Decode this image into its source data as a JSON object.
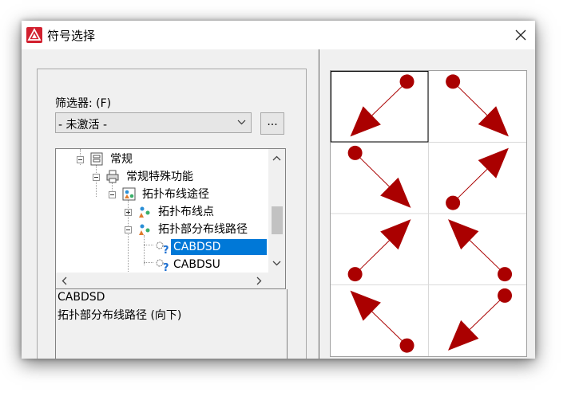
{
  "window": {
    "title": "符号选择"
  },
  "filter": {
    "label": "筛选器: (F)",
    "value": "- 未激活 -",
    "browse_label": "..."
  },
  "tree": {
    "items": [
      {
        "label": "常规"
      },
      {
        "label": "常规特殊功能"
      },
      {
        "label": "拓扑布线途径"
      },
      {
        "label": "拓扑布线点"
      },
      {
        "label": "拓扑部分布线路径"
      },
      {
        "label": "CABDSD"
      },
      {
        "label": "CABDSU"
      }
    ],
    "selected": "CABDSD"
  },
  "description": {
    "line1": "CABDSD",
    "line2": "拓扑部分布线路径 (向下)"
  },
  "preview": {
    "arrow_color": "#aa0000",
    "cells": [
      {
        "direction": "down-left"
      },
      {
        "direction": "down-right"
      },
      {
        "direction": "down-right"
      },
      {
        "direction": "up-right"
      },
      {
        "direction": "up-right"
      },
      {
        "direction": "up-left"
      },
      {
        "direction": "up-left"
      },
      {
        "direction": "down-left"
      }
    ],
    "selected_index": 0
  }
}
